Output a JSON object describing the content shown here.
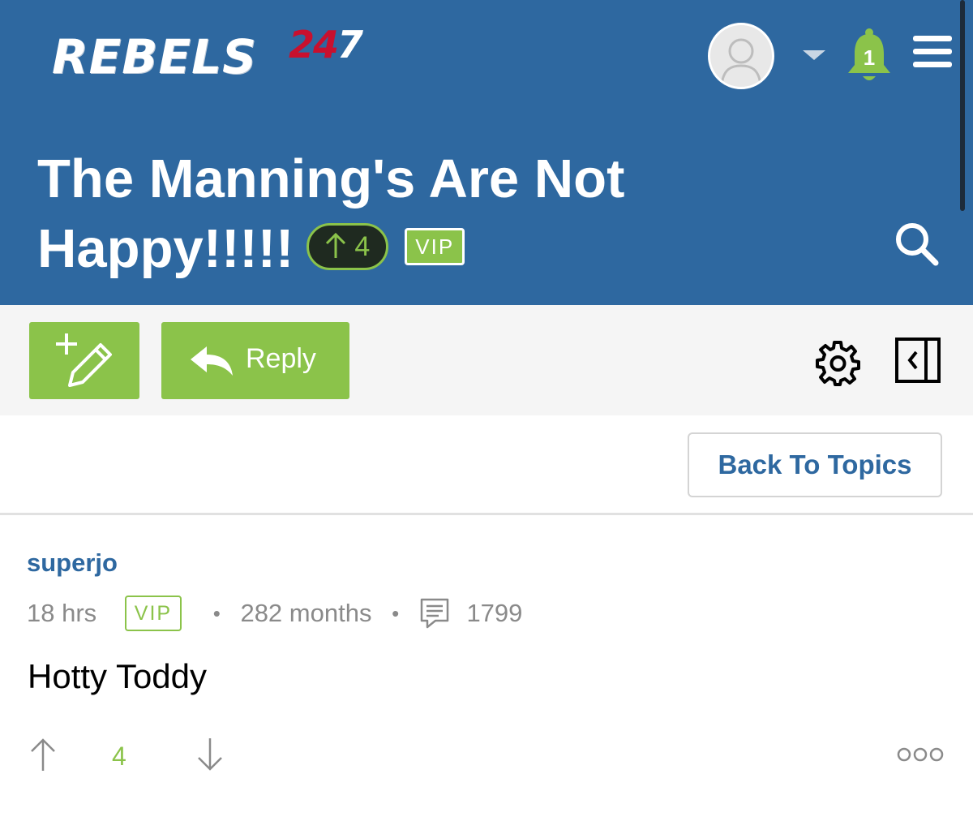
{
  "header": {
    "logo_word": "REBELS",
    "logo_digits": [
      "2",
      "4",
      "7"
    ],
    "notification_count": "1",
    "title": "The Manning's Are Not Happy!!!!!",
    "upvotes": "4",
    "vip_label": "VIP"
  },
  "toolbar": {
    "reply_label": "Reply"
  },
  "nav": {
    "back_label": "Back To Topics"
  },
  "post": {
    "author": "superjo",
    "time": "18 hrs",
    "vip_label": "VIP",
    "member_duration": "282 months",
    "post_count": "1799",
    "body": "Hotty Toddy",
    "vote_count": "4"
  },
  "colors": {
    "header_bg": "#2e68a0",
    "accent_green": "#8bc34a",
    "toolbar_bg": "#f5f5f5",
    "link_blue": "#2e68a0",
    "logo_red": "#c8102e"
  },
  "icons": {
    "avatar": "user-silhouette-icon",
    "caret": "caret-down-icon",
    "bell": "bell-icon",
    "menu": "hamburger-menu-icon",
    "search": "search-icon",
    "new_topic": "pencil-plus-icon",
    "reply": "reply-arrow-icon",
    "settings": "gear-icon",
    "panel": "sidebar-collapse-icon",
    "comments": "comment-icon",
    "upvote": "arrow-up-icon",
    "downvote": "arrow-down-icon",
    "more": "more-options-icon"
  }
}
